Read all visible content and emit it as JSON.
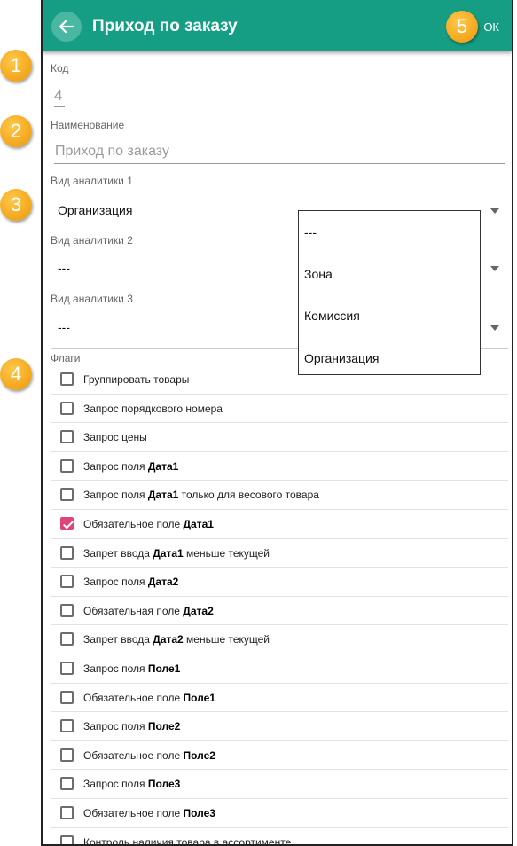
{
  "appbar": {
    "title": "Приход по заказу",
    "ok_label": "ОК"
  },
  "fields": {
    "code": {
      "label": "Код",
      "value": "4"
    },
    "name": {
      "label": "Наименование",
      "placeholder": "Приход по заказу"
    },
    "analytics1": {
      "label": "Вид аналитики 1",
      "value": "Организация"
    },
    "analytics2": {
      "label": "Вид аналитики 2",
      "value": "---"
    },
    "analytics3": {
      "label": "Вид аналитики 3",
      "value": "---"
    }
  },
  "flags": {
    "label": "Флаги",
    "items": [
      {
        "pre": "Группировать товары",
        "bold": "",
        "post": "",
        "checked": false
      },
      {
        "pre": "Запрос порядкового номера",
        "bold": "",
        "post": "",
        "checked": false
      },
      {
        "pre": "Запрос цены",
        "bold": "",
        "post": "",
        "checked": false
      },
      {
        "pre": "Запрос поля ",
        "bold": "Дата1",
        "post": "",
        "checked": false
      },
      {
        "pre": "Запрос поля ",
        "bold": "Дата1",
        "post": " только для весового товара",
        "checked": false
      },
      {
        "pre": "Обязательное поле ",
        "bold": "Дата1",
        "post": "",
        "checked": true
      },
      {
        "pre": "Запрет ввода ",
        "bold": "Дата1",
        "post": " меньше текущей",
        "checked": false
      },
      {
        "pre": "Запрос поля ",
        "bold": "Дата2",
        "post": "",
        "checked": false
      },
      {
        "pre": "Обязательная поле ",
        "bold": "Дата2",
        "post": "",
        "checked": false
      },
      {
        "pre": "Запрет ввода ",
        "bold": "Дата2",
        "post": " меньше текущей",
        "checked": false
      },
      {
        "pre": "Запрос поля ",
        "bold": "Поле1",
        "post": "",
        "checked": false
      },
      {
        "pre": "Обязательное поле ",
        "bold": "Поле1",
        "post": "",
        "checked": false
      },
      {
        "pre": "Запрос поля ",
        "bold": "Поле2",
        "post": "",
        "checked": false
      },
      {
        "pre": "Обязательное поле ",
        "bold": "Поле2",
        "post": "",
        "checked": false
      },
      {
        "pre": "Запрос поля ",
        "bold": "Поле3",
        "post": "",
        "checked": false
      },
      {
        "pre": "Обязательное поле ",
        "bold": "Поле3",
        "post": "",
        "checked": false
      },
      {
        "pre": "Контроль наличия товара в ассортименте",
        "bold": "",
        "post": "",
        "checked": false
      }
    ]
  },
  "dropdown": {
    "options": [
      "---",
      "Зона",
      "Комиссия",
      "Организация"
    ]
  },
  "badges": [
    "1",
    "2",
    "3",
    "4",
    "5"
  ],
  "colors": {
    "appbar": "#169e85",
    "checkbox_checked": "#e0457a",
    "badge": "#f2a51b"
  },
  "icons": {
    "back": "arrow-left-icon",
    "dropdown": "triangle-down-icon"
  }
}
